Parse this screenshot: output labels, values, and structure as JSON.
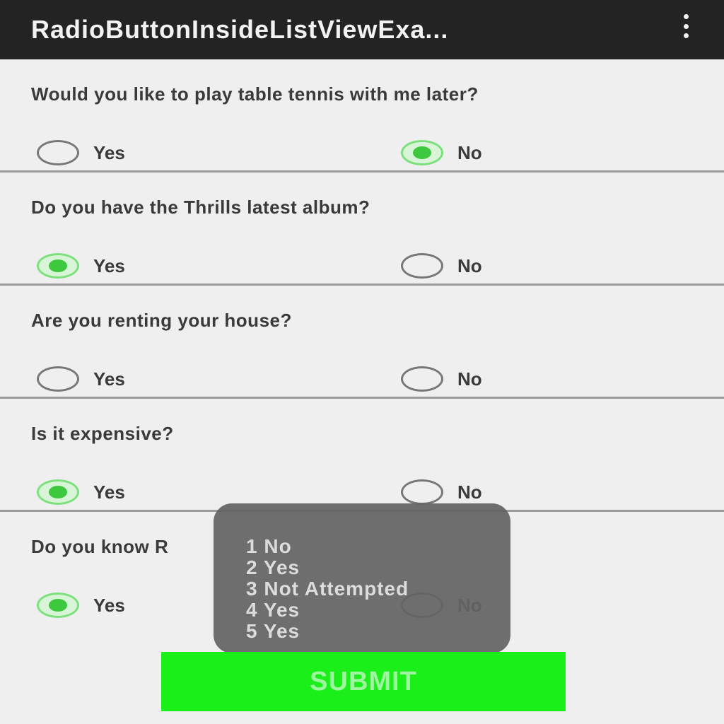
{
  "appbar": {
    "title": "RadioButtonInsideListViewExa...",
    "menu_icon": "overflow-menu-icon"
  },
  "questions": [
    {
      "text": "Would you like to play table tennis with me later?",
      "yes_label": "Yes",
      "no_label": "No",
      "selected": "No"
    },
    {
      "text": "Do you have the Thrills latest album?",
      "yes_label": "Yes",
      "no_label": "No",
      "selected": "Yes"
    },
    {
      "text": "Are you renting your house?",
      "yes_label": "Yes",
      "no_label": "No",
      "selected": null
    },
    {
      "text": "Is it expensive?",
      "yes_label": "Yes",
      "no_label": "No",
      "selected": "Yes"
    },
    {
      "text": "Do you know R",
      "yes_label": "Yes",
      "no_label": "No",
      "selected": "Yes"
    }
  ],
  "toast": {
    "lines": [
      "1 No",
      "2 Yes",
      "3 Not Attempted",
      "4 Yes",
      "5 Yes"
    ]
  },
  "submit_label": "SUBMIT",
  "colors": {
    "appbar": "#232323",
    "radio_checked": "#3ec83e",
    "submit_bg": "#1aef1a",
    "submit_text": "#9ef79e"
  }
}
